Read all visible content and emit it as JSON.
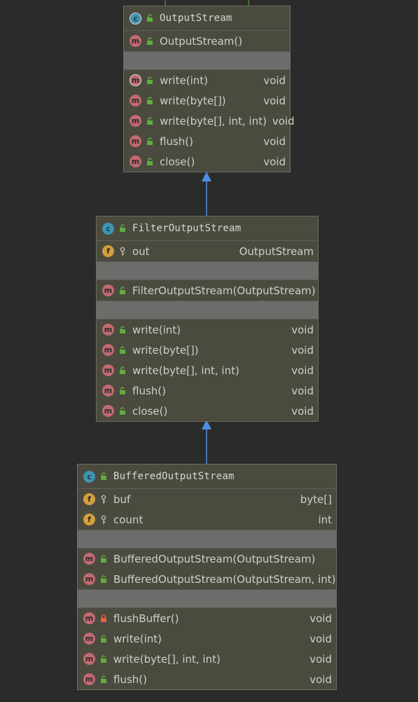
{
  "colors": {
    "background": "#2b2b2b",
    "box": "#4b4a3f",
    "method_badge": "#c16a6f",
    "field_badge": "#d3a03e",
    "class_badge": "#3d95b0",
    "public_lock": "#5fae3c",
    "private_lock": "#e0643f",
    "arrow": "#4e8fe0"
  },
  "classes": {
    "output_stream": {
      "title": "OutputStream",
      "constructors": [
        {
          "name": "OutputStream()",
          "type": ""
        }
      ],
      "methods": [
        {
          "name": "write(int)",
          "type": "void"
        },
        {
          "name": "write(byte[])",
          "type": "void"
        },
        {
          "name": "write(byte[], int, int)",
          "type": "void"
        },
        {
          "name": "flush()",
          "type": "void"
        },
        {
          "name": "close()",
          "type": "void"
        }
      ]
    },
    "filter_output_stream": {
      "title": "FilterOutputStream",
      "fields": [
        {
          "name": "out",
          "type": "OutputStream"
        }
      ],
      "constructors": [
        {
          "name": "FilterOutputStream(OutputStream)",
          "type": ""
        }
      ],
      "methods": [
        {
          "name": "write(int)",
          "type": "void"
        },
        {
          "name": "write(byte[])",
          "type": "void"
        },
        {
          "name": "write(byte[], int, int)",
          "type": "void"
        },
        {
          "name": "flush()",
          "type": "void"
        },
        {
          "name": "close()",
          "type": "void"
        }
      ]
    },
    "buffered_output_stream": {
      "title": "BufferedOutputStream",
      "fields": [
        {
          "name": "buf",
          "type": "byte[]"
        },
        {
          "name": "count",
          "type": "int"
        }
      ],
      "constructors": [
        {
          "name": "BufferedOutputStream(OutputStream)",
          "type": ""
        },
        {
          "name": "BufferedOutputStream(OutputStream, int)",
          "type": ""
        }
      ],
      "methods": [
        {
          "name": "flushBuffer()",
          "type": "void",
          "access": "private"
        },
        {
          "name": "write(int)",
          "type": "void"
        },
        {
          "name": "write(byte[], int, int)",
          "type": "void"
        },
        {
          "name": "flush()",
          "type": "void"
        }
      ]
    }
  },
  "icons": {
    "class": "c",
    "method": "m",
    "field": "f"
  }
}
